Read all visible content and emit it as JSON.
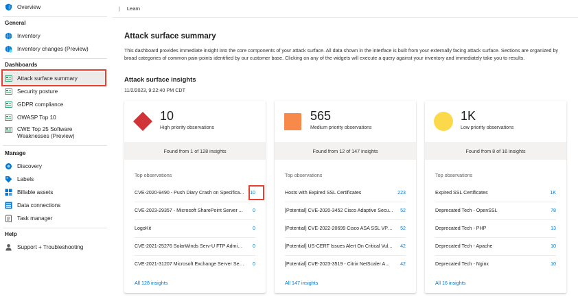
{
  "sidebar": {
    "overview": "Overview",
    "general_heading": "General",
    "general_items": [
      "Inventory",
      "Inventory changes (Preview)"
    ],
    "dashboards_heading": "Dashboards",
    "dashboard_items": [
      "Attack surface summary",
      "Security posture",
      "GDPR compliance",
      "OWASP Top 10",
      "CWE Top 25 Software Weaknesses (Preview)"
    ],
    "manage_heading": "Manage",
    "manage_items": [
      "Discovery",
      "Labels",
      "Billable assets",
      "Data connections",
      "Task manager"
    ],
    "help_heading": "Help",
    "help_items": [
      "Support + Troubleshooting"
    ]
  },
  "breadcrumb": {
    "label": "Learn"
  },
  "main": {
    "title": "Attack surface summary",
    "description": "This dashboard provides immediate insight into the core components of your attack surface. All data shown in the interface is built from your externally facing attack surface. Sections are organized by broad categories of common pain-points identified by our customer base. Clicking on any of the widgets will execute a query against your inventory and immediately take you to results.",
    "insights_title": "Attack surface insights",
    "timestamp": "11/2/2023, 9:22:40 PM CDT"
  },
  "colors": {
    "high": "#d13438",
    "medium": "#f7894a",
    "low": "#fcd94a",
    "link": "#0078d4",
    "highlight": "#e8402f"
  },
  "cards": [
    {
      "count": "10",
      "label": "High priority observations",
      "found": "Found from 1 of 128 insights",
      "top_label": "Top observations",
      "rows": [
        {
          "name": "CVE-2020-9490 - Push Diary Crash on Specifica...",
          "value": "10"
        },
        {
          "name": "CVE-2023-29357 - Microsoft SharePoint Server ...",
          "value": "0"
        },
        {
          "name": "LogoKit",
          "value": "0"
        },
        {
          "name": "CVE-2021-25276 SolarWinds Serv-U FTP Admin ...",
          "value": "0"
        },
        {
          "name": "CVE-2021-31207 Microsoft Exchange Server Sec...",
          "value": "0"
        }
      ],
      "all_link": "All 128 insights"
    },
    {
      "count": "565",
      "label": "Medium priority observations",
      "found": "Found from 12 of 147 insights",
      "top_label": "Top observations",
      "rows": [
        {
          "name": "Hosts with Expired SSL Certificates",
          "value": "223"
        },
        {
          "name": "[Potential] CVE-2020-3452 Cisco Adaptive Secu...",
          "value": "52"
        },
        {
          "name": "[Potential] CVE-2022-20699 Cisco ASA SSL VPN...",
          "value": "52"
        },
        {
          "name": "[Potential] US-CERT Issues Alert On Critical Vul...",
          "value": "42"
        },
        {
          "name": "[Potential] CVE-2023-3519 - Citrix NetScaler A...",
          "value": "42"
        }
      ],
      "all_link": "All 147 insights"
    },
    {
      "count": "1K",
      "label": "Low priority observations",
      "found": "Found from 8 of 16 insights",
      "top_label": "Top observations",
      "rows": [
        {
          "name": "Expired SSL Certificates",
          "value": "1K"
        },
        {
          "name": "Deprecated Tech - OpenSSL",
          "value": "78"
        },
        {
          "name": "Deprecated Tech - PHP",
          "value": "13"
        },
        {
          "name": "Deprecated Tech - Apache",
          "value": "10"
        },
        {
          "name": "Deprecated Tech - Nginx",
          "value": "10"
        }
      ],
      "all_link": "All 16 insights"
    }
  ]
}
